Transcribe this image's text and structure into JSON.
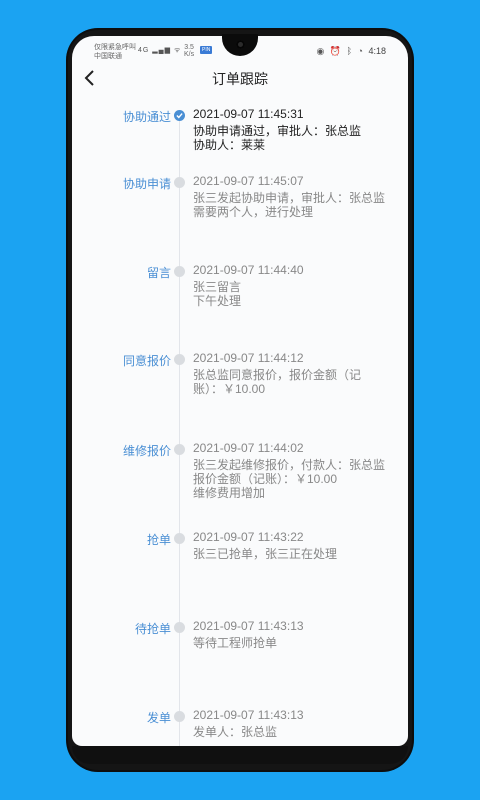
{
  "status_bar": {
    "carrier_line1": "仅限紧急呼叫",
    "carrier_line2": "中国联通",
    "net_speed_value": "3.5",
    "net_speed_unit": "K/s",
    "signal_text": "4G",
    "app_badge": "PIN",
    "time": "4:18"
  },
  "header": {
    "title": "订单跟踪"
  },
  "timeline": [
    {
      "status": "协助通过",
      "time": "2021-09-07 11:45:31",
      "lines": [
        "协助申请通过，审批人：张总监",
        "协助人：莱莱"
      ],
      "current": true
    },
    {
      "status": "协助申请",
      "time": "2021-09-07 11:45:07",
      "lines": [
        "张三发起协助申请，审批人：张总监",
        "需要两个人，进行处理"
      ],
      "current": false
    },
    {
      "status": "留言",
      "time": "2021-09-07 11:44:40",
      "lines": [
        "张三留言",
        "下午处理"
      ],
      "current": false
    },
    {
      "status": "同意报价",
      "time": "2021-09-07 11:44:12",
      "lines": [
        "张总监同意报价，报价金额（记",
        "账）：￥10.00"
      ],
      "current": false
    },
    {
      "status": "维修报价",
      "time": "2021-09-07 11:44:02",
      "lines": [
        "张三发起维修报价，付款人：张总监",
        "报价金额（记账）：￥10.00",
        "维修费用增加"
      ],
      "current": false
    },
    {
      "status": "抢单",
      "time": "2021-09-07 11:43:22",
      "lines": [
        "张三已抢单，张三正在处理"
      ],
      "current": false
    },
    {
      "status": "待抢单",
      "time": "2021-09-07 11:43:13",
      "lines": [
        "等待工程师抢单"
      ],
      "current": false
    },
    {
      "status": "发单",
      "time": "2021-09-07 11:43:13",
      "lines": [
        "发单人：张总监"
      ],
      "current": false
    }
  ]
}
